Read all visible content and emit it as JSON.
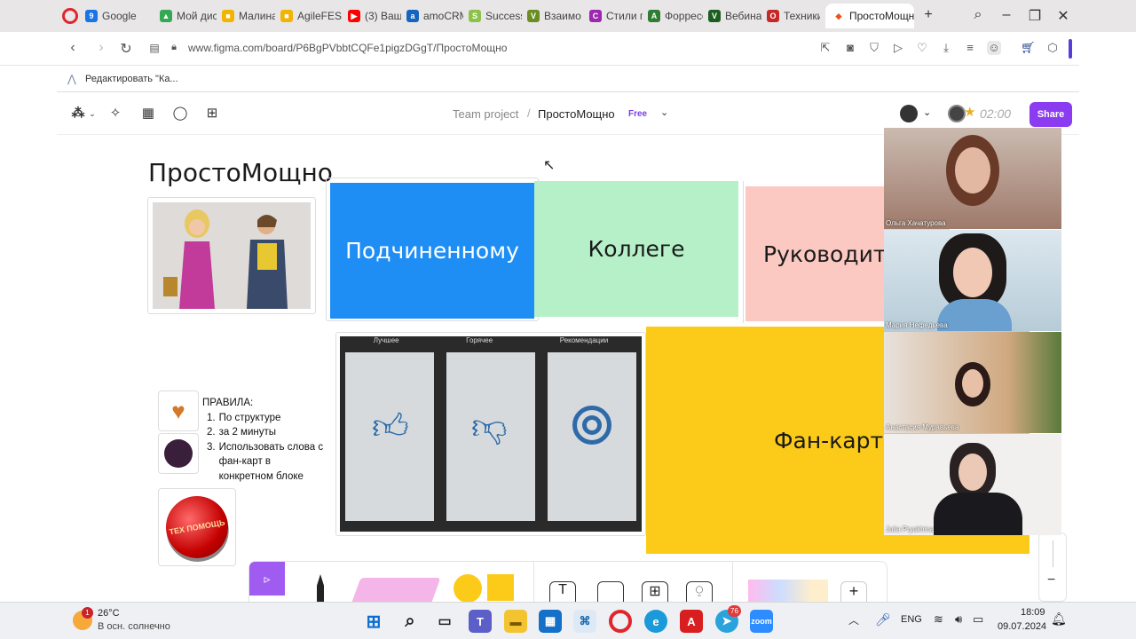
{
  "browser": {
    "tabs": [
      {
        "label": "Google",
        "color": "#1a73e8",
        "glyph": "9"
      },
      {
        "label": "Мой дис",
        "color": "#34a853",
        "glyph": "▲"
      },
      {
        "label": "Малина",
        "color": "#f2b400",
        "glyph": "■"
      },
      {
        "label": "AgileFES",
        "color": "#f2b400",
        "glyph": "■"
      },
      {
        "label": "(3) Ваш",
        "color": "#ff0000",
        "glyph": "▶"
      },
      {
        "label": "amoCRM",
        "color": "#1565c0",
        "glyph": "a"
      },
      {
        "label": "Successf",
        "color": "#8bc34a",
        "glyph": "S"
      },
      {
        "label": "Взаимо",
        "color": "#6b8e23",
        "glyph": "V"
      },
      {
        "label": "Стили п",
        "color": "#9c27b0",
        "glyph": "C"
      },
      {
        "label": "Форресс",
        "color": "#2e7d32",
        "glyph": "A"
      },
      {
        "label": "Вебинар",
        "color": "#1b5e20",
        "glyph": "V"
      },
      {
        "label": "Техники",
        "color": "#c62828",
        "glyph": "O"
      }
    ],
    "active_tab": "ПростоМощно",
    "url": "www.figma.com/board/P6BgPVbbtCQFe1pigzDGgT/ПростоМощно",
    "bookmark": "Редактировать \"Ка..."
  },
  "figma": {
    "team": "Team project",
    "separator": "/",
    "file": "ПростоМощно",
    "plan": "Free",
    "timer": "02:00",
    "share": "Share"
  },
  "board": {
    "title": "ПростоМощно",
    "cards": {
      "subordinate": "Подчиненному",
      "colleague": "Коллеге",
      "manager": "Руководит",
      "fan_cards": "Фан-карт"
    },
    "phone_tabs": [
      "Лучшее",
      "Горячее",
      "Рекомендации"
    ],
    "rules_title": "ПРАВИЛА:",
    "rules": [
      {
        "num": "1.",
        "text": "По структуре"
      },
      {
        "num": "2.",
        "text": "за 2 минуты"
      },
      {
        "num": "3.",
        "text": "Использовать слова с фан-карт в конкретном блоке"
      }
    ],
    "button_text": "ТЕХ ПОМОЩЬ"
  },
  "participants": [
    "Ольга Хачатурова",
    "Мария Нефедьева",
    "Анастасия Муравьева",
    "Julia Pryakhina"
  ],
  "zoom": {
    "minus": "−"
  },
  "taskbar": {
    "temp": "26°C",
    "weather": "В осн. солнечно",
    "weather_badge": "1",
    "lang": "ENG",
    "time": "18:09",
    "date": "09.07.2024",
    "telegram_badge": "76"
  }
}
